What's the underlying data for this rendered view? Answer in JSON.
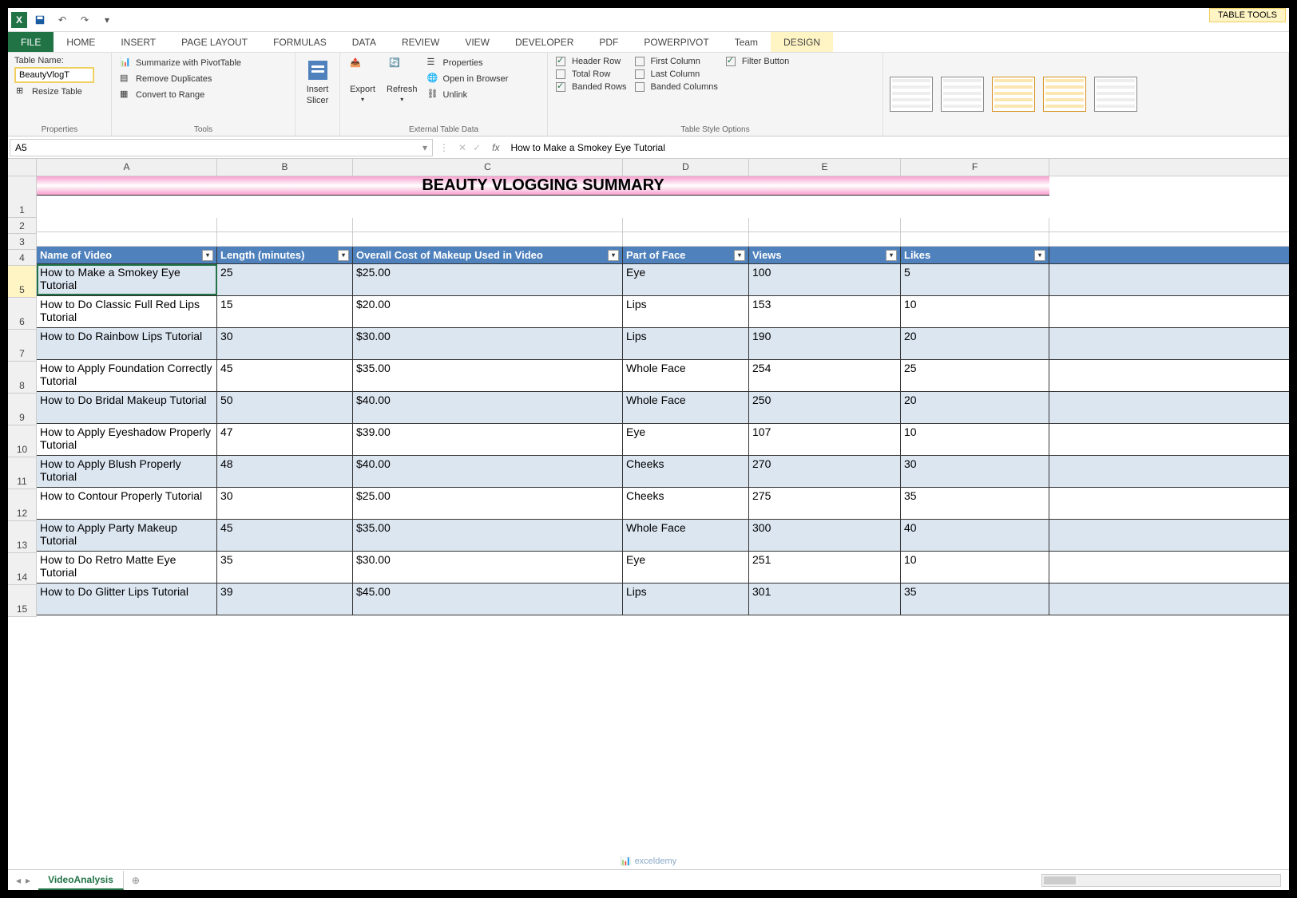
{
  "title_tools": "TABLE TOOLS",
  "tabs": [
    "FILE",
    "HOME",
    "INSERT",
    "PAGE LAYOUT",
    "FORMULAS",
    "DATA",
    "REVIEW",
    "VIEW",
    "DEVELOPER",
    "PDF",
    "POWERPIVOT",
    "Team",
    "DESIGN"
  ],
  "ribbon": {
    "properties": {
      "label": "Properties",
      "tablename_label": "Table Name:",
      "tablename_value": "BeautyVlogT",
      "resize": "Resize Table"
    },
    "tools": {
      "label": "Tools",
      "pivot": "Summarize with PivotTable",
      "dup": "Remove Duplicates",
      "range": "Convert to Range"
    },
    "slicer": {
      "label1": "Insert",
      "label2": "Slicer"
    },
    "export": "Export",
    "refresh": "Refresh",
    "ext": {
      "label": "External Table Data",
      "props": "Properties",
      "browser": "Open in Browser",
      "unlink": "Unlink"
    },
    "styleopts": {
      "label": "Table Style Options",
      "header": "Header Row",
      "total": "Total Row",
      "banded_r": "Banded Rows",
      "first": "First Column",
      "last": "Last Column",
      "banded_c": "Banded Columns",
      "filter": "Filter Button"
    }
  },
  "namebox": "A5",
  "formula": "How to Make a Smokey Eye Tutorial",
  "cols": [
    "A",
    "B",
    "C",
    "D",
    "E",
    "F"
  ],
  "title": "BEAUTY VLOGGING SUMMARY",
  "headers": [
    "Name of Video",
    "Length (minutes)",
    "Overall Cost of Makeup Used in Video",
    "Part of Face",
    "Views",
    "Likes"
  ],
  "rows": [
    {
      "n": 5,
      "name": "How to Make a Smokey Eye Tutorial",
      "len": "25",
      "cost": "$25.00",
      "part": "Eye",
      "views": "100",
      "likes": "5"
    },
    {
      "n": 6,
      "name": "How to Do Classic Full Red Lips Tutorial",
      "len": "15",
      "cost": "$20.00",
      "part": "Lips",
      "views": "153",
      "likes": "10"
    },
    {
      "n": 7,
      "name": "How to Do Rainbow Lips Tutorial",
      "len": "30",
      "cost": "$30.00",
      "part": "Lips",
      "views": "190",
      "likes": "20"
    },
    {
      "n": 8,
      "name": "How to Apply Foundation Correctly Tutorial",
      "len": "45",
      "cost": "$35.00",
      "part": "Whole Face",
      "views": "254",
      "likes": "25"
    },
    {
      "n": 9,
      "name": "How to Do Bridal Makeup Tutorial",
      "len": "50",
      "cost": "$40.00",
      "part": "Whole Face",
      "views": "250",
      "likes": "20"
    },
    {
      "n": 10,
      "name": "How to Apply Eyeshadow Properly Tutorial",
      "len": "47",
      "cost": "$39.00",
      "part": "Eye",
      "views": "107",
      "likes": "10"
    },
    {
      "n": 11,
      "name": "How to Apply Blush Properly Tutorial",
      "len": "48",
      "cost": "$40.00",
      "part": "Cheeks",
      "views": "270",
      "likes": "30"
    },
    {
      "n": 12,
      "name": "How to Contour Properly Tutorial",
      "len": "30",
      "cost": "$25.00",
      "part": "Cheeks",
      "views": "275",
      "likes": "35"
    },
    {
      "n": 13,
      "name": "How to Apply Party Makeup Tutorial",
      "len": "45",
      "cost": "$35.00",
      "part": "Whole Face",
      "views": "300",
      "likes": "40"
    },
    {
      "n": 14,
      "name": "How to Do Retro Matte Eye Tutorial",
      "len": "35",
      "cost": "$30.00",
      "part": "Eye",
      "views": "251",
      "likes": "10"
    },
    {
      "n": 15,
      "name": "How to Do Glitter Lips Tutorial",
      "len": "39",
      "cost": "$45.00",
      "part": "Lips",
      "views": "301",
      "likes": "35"
    }
  ],
  "sheet": "VideoAnalysis",
  "watermark": "exceldemy"
}
